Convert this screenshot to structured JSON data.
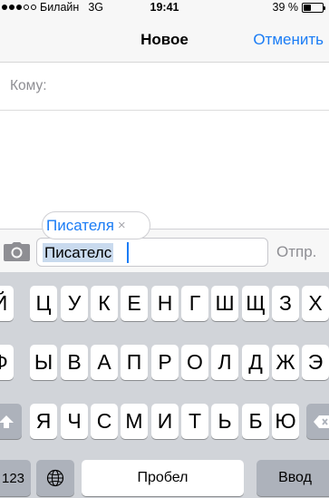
{
  "status_bar": {
    "carrier": "Билайн",
    "network": "3G",
    "time": "19:41",
    "battery_percent": "39 %",
    "battery_level": 0.39,
    "signal_bars": 5,
    "signal_filled": 3
  },
  "nav": {
    "title": "Новое",
    "cancel_label": "Отменить"
  },
  "recipient": {
    "label": "Кому:"
  },
  "suggestion": {
    "name": "Писателя",
    "remove_glyph": "×"
  },
  "compose": {
    "text": "Писателс",
    "send_label": "Отпр."
  },
  "keyboard": {
    "row1": [
      "Й",
      "Ц",
      "У",
      "К",
      "Е",
      "Н",
      "Г",
      "Ш",
      "Щ",
      "З",
      "Х"
    ],
    "row2": [
      "Ф",
      "Ы",
      "В",
      "А",
      "П",
      "Р",
      "О",
      "Л",
      "Д",
      "Ж",
      "Э"
    ],
    "row3": [
      "Я",
      "Ч",
      "С",
      "М",
      "И",
      "Т",
      "Ь",
      "Б",
      "Ю"
    ],
    "numbers_label": "123",
    "space_label": "Пробел",
    "return_label": "Ввод"
  },
  "colors": {
    "accent": "#1a7cf5",
    "keyboard_bg": "#d1d4d9",
    "selection": "#c9daee"
  },
  "icons": {
    "camera": "camera-icon",
    "globe": "globe-icon",
    "shift": "shift-icon",
    "backspace": "backspace-icon"
  }
}
